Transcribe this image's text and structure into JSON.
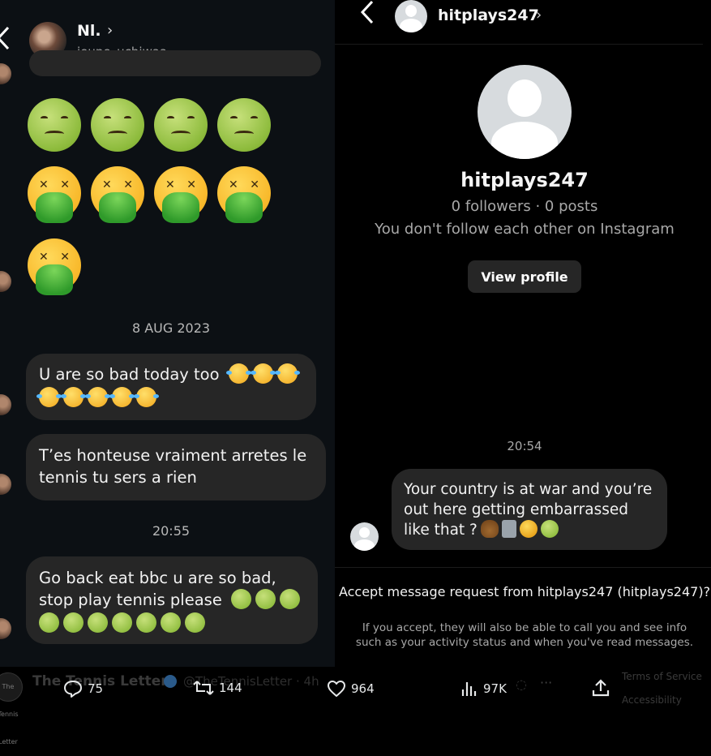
{
  "left_chat": {
    "back_icon": "chevron-left-icon",
    "contact_name": "Nl.",
    "contact_username": "jeune_uchiwaa",
    "date_separator": "8 AUG 2023",
    "time_separator": "20:55",
    "messages": [
      {
        "text": "U are so bad today too",
        "emoji": [
          "laughing-tears-emoji",
          "laughing-tears-emoji",
          "laughing-tears-emoji",
          "laughing-tears-emoji",
          "laughing-tears-emoji",
          "laughing-tears-emoji",
          "laughing-tears-emoji",
          "laughing-tears-emoji"
        ]
      },
      {
        "text": "T’es honteuse vraiment arretes le tennis tu sers a rien"
      },
      {
        "text": "Go back eat bbc u are so bad, stop play tennis please",
        "emoji": [
          "nauseated-face-emoji",
          "nauseated-face-emoji",
          "nauseated-face-emoji",
          "nauseated-face-emoji",
          "nauseated-face-emoji",
          "nauseated-face-emoji",
          "nauseated-face-emoji",
          "nauseated-face-emoji",
          "nauseated-face-emoji",
          "nauseated-face-emoji"
        ]
      }
    ],
    "big_emoji_rows": [
      [
        "nauseated-face-emoji",
        "nauseated-face-emoji",
        "nauseated-face-emoji",
        "nauseated-face-emoji"
      ],
      [
        "vomiting-face-emoji",
        "vomiting-face-emoji",
        "vomiting-face-emoji",
        "vomiting-face-emoji"
      ],
      [
        "vomiting-face-emoji"
      ]
    ]
  },
  "right_chat": {
    "back_icon": "chevron-left-icon",
    "header_name": "hitplays247",
    "profile": {
      "name": "hitplays247",
      "stats": "0 followers · 0 posts",
      "follow_note": "You don't follow each other on Instagram",
      "view_profile_label": "View profile"
    },
    "time_separator": "20:54",
    "message": {
      "text": "Your country is at war and you’re out here getting embarrassed like that ?",
      "emoji": [
        "poop-emoji",
        "wastebasket-emoji",
        "vomiting-face-emoji",
        "nauseated-face-emoji"
      ]
    },
    "accept_title": "Accept message request from hitplays247 (hitplays247)?",
    "accept_subtitle": "If you accept, they will also be able to call you and see info such as your activity status and when you've read messages."
  },
  "tweet_bar": {
    "author": "The Tennis Letter",
    "handle": "@TheTennisLetter · 4h",
    "avatar_text": "The Tennis Letter",
    "actions": {
      "replies": "75",
      "reposts": "144",
      "likes": "964",
      "views": "97K"
    },
    "footer_terms": "Terms of Service",
    "footer_access": "Accessibility"
  },
  "colors": {
    "left_bg": "#0c1014",
    "right_bg": "#000000",
    "bubble": "#262626",
    "muted_text": "#a8a8a8"
  }
}
